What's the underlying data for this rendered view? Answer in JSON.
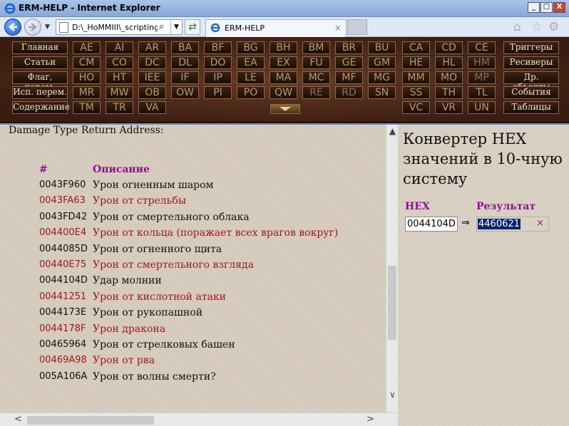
{
  "window": {
    "title": "ERM-HELP - Internet Explorer",
    "min": "_",
    "max": "□",
    "close": "X"
  },
  "nav": {
    "address": "D:\\_HoMMIII\\_scripting\\",
    "tab_title": "ERM-HELP",
    "tab_close": "×",
    "drop": "▼",
    "search": "⌕",
    "refresh": "⇄"
  },
  "tools": {
    "home": "⌂",
    "fav": "☆",
    "settings": "⚙"
  },
  "menu": {
    "left": [
      "Главная",
      "Статьи",
      "Флаг, перем.",
      "Исп. перем.",
      "Содержание"
    ],
    "right": [
      "Триггеры",
      "Ресиверы",
      "Др. объекты",
      "События",
      "Таблицы"
    ],
    "row1": [
      "AE",
      "AI",
      "AR",
      "BA",
      "BF",
      "BG",
      "BH",
      "BM",
      "BR",
      "BU",
      "CA",
      "CD",
      "CE"
    ],
    "row2": [
      "CM",
      "CO",
      "DC",
      "DL",
      "DO",
      "EA",
      "EX",
      "FU",
      "GE",
      "GM",
      "HE",
      "HL",
      "HM"
    ],
    "row3": [
      "HO",
      "HT",
      "IEE",
      "IF",
      "IP",
      "LE",
      "MA",
      "MC",
      "MF",
      "MG",
      "MM",
      "MO",
      "MP"
    ],
    "row4": [
      "MR",
      "MW",
      "OB",
      "OW",
      "PI",
      "PO",
      "QW",
      "RE",
      "RD",
      "SN",
      "SS",
      "TH",
      "TL"
    ],
    "row5a": [
      "TM",
      "TR",
      "VA"
    ],
    "row5b": [
      "VC",
      "VR",
      "UN"
    ]
  },
  "main": {
    "intro": "Damage Type Return Address:",
    "col_hash": "#",
    "col_desc": "Описание",
    "rows": [
      {
        "addr": "0043F960",
        "desc": "Урон огненным шаром"
      },
      {
        "addr": "0043FA63",
        "desc": "Урон от стрельбы"
      },
      {
        "addr": "0043FD42",
        "desc": "Урон от смертельного облака"
      },
      {
        "addr": "004400E4",
        "desc": "Урон от кольца (поражает всех врагов вокруг)"
      },
      {
        "addr": "0044085D",
        "desc": "Урон от огненного щита"
      },
      {
        "addr": "00440E75",
        "desc": "Урон от смертельного взгляда"
      },
      {
        "addr": "0044104D",
        "desc": "Удар молнии"
      },
      {
        "addr": "00441251",
        "desc": "Урон от кислотной атаки"
      },
      {
        "addr": "0044173E",
        "desc": "Урон от рукопашной"
      },
      {
        "addr": "0044178F",
        "desc": "Урон дракона"
      },
      {
        "addr": "00465964",
        "desc": "Урон от стрелковых башен"
      },
      {
        "addr": "00469A98",
        "desc": "Урон от рва"
      },
      {
        "addr": "005A106A",
        "desc": "Урон от волны смерти?"
      }
    ]
  },
  "converter": {
    "title": "Конвертер HEX значений в 10-чную систему",
    "hex_label": "HEX",
    "result_label": "Результат",
    "hex_value": "0044104D",
    "arrow": "⇒",
    "result_value": "4460621",
    "clear": "×"
  },
  "scroll": {
    "up": "▲",
    "down": "∨",
    "left": "<",
    "right": ">"
  },
  "colors": {
    "accent_purple": "#8a148a",
    "alt_row_red": "#a01818",
    "menu_brown": "#4a2716"
  }
}
